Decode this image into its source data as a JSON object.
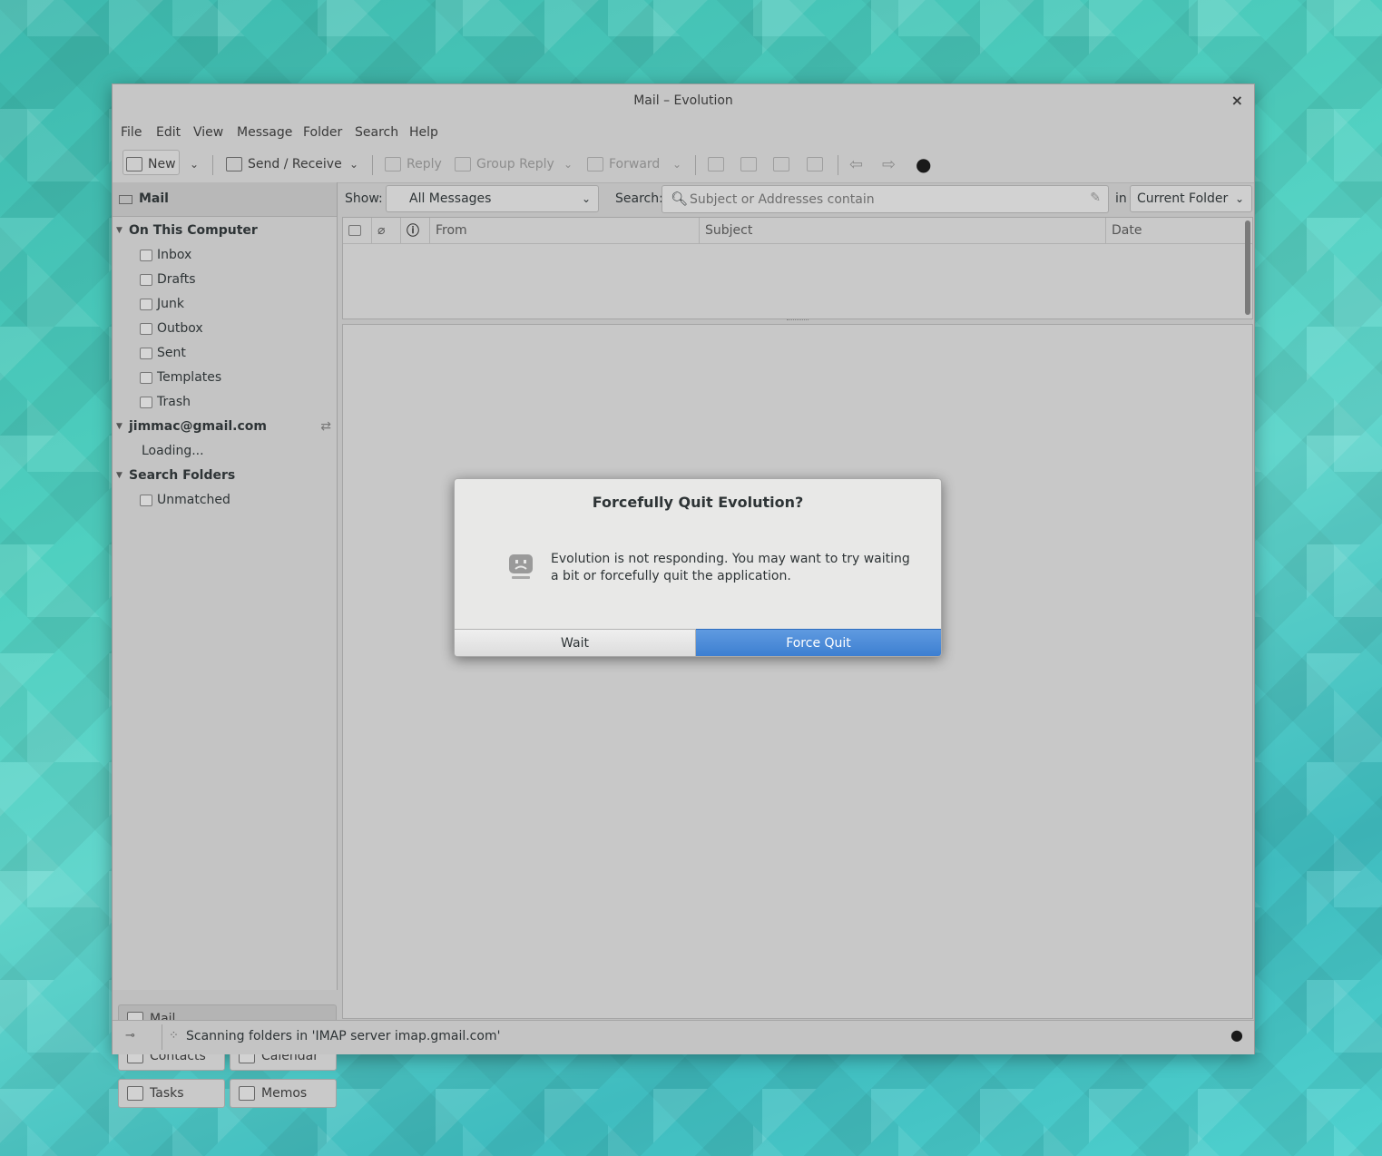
{
  "window": {
    "title": "Mail – Evolution",
    "close": "×"
  },
  "menu": [
    "File",
    "Edit",
    "View",
    "Message",
    "Folder",
    "Search",
    "Help"
  ],
  "toolbar": {
    "new": "New",
    "send_receive": "Send / Receive",
    "reply": "Reply",
    "group_reply": "Group Reply",
    "forward": "Forward"
  },
  "sidebar": {
    "header": "Mail",
    "local_account": "On This Computer",
    "local_folders": [
      "Inbox",
      "Drafts",
      "Junk",
      "Outbox",
      "Sent",
      "Templates",
      "Trash"
    ],
    "remote_account": "jimmac@gmail.com",
    "remote_status": "Loading...",
    "search_folders": "Search Folders",
    "search_items": [
      "Unmatched"
    ]
  },
  "switcher": {
    "mail": "Mail",
    "contacts": "Contacts",
    "calendar": "Calendar",
    "tasks": "Tasks",
    "memos": "Memos"
  },
  "filter": {
    "show_label": "Show:",
    "show_value": "All Messages",
    "search_label": "Search:",
    "search_placeholder": "Subject or Addresses contain",
    "in_label": "in",
    "scope_value": "Current Folder"
  },
  "columns": {
    "from": "From",
    "subject": "Subject",
    "date": "Date"
  },
  "status": {
    "message": "Scanning folders in 'IMAP server imap.gmail.com'"
  },
  "dialog": {
    "title": "Forcefully Quit Evolution?",
    "line1": "Evolution is not responding. You may want to try waiting",
    "line2": "a bit or forcefully quit the application.",
    "wait": "Wait",
    "force_quit": "Force Quit"
  },
  "colors": {
    "accent": "#4a8bd8",
    "window_bg": "#bfbfbf",
    "dialog_bg": "#e8e8e7"
  }
}
